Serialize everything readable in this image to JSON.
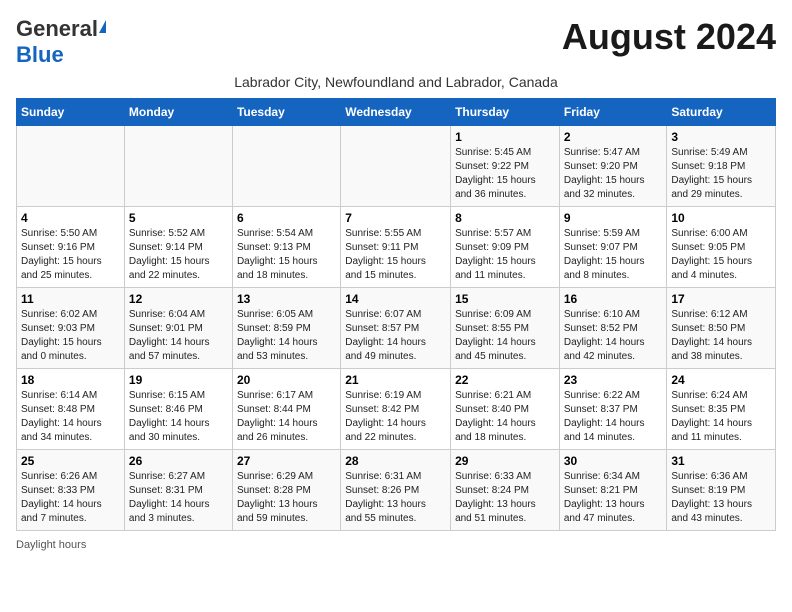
{
  "header": {
    "logo_general": "General",
    "logo_blue": "Blue",
    "month_title": "August 2024",
    "subtitle": "Labrador City, Newfoundland and Labrador, Canada"
  },
  "days_of_week": [
    "Sunday",
    "Monday",
    "Tuesday",
    "Wednesday",
    "Thursday",
    "Friday",
    "Saturday"
  ],
  "footer": {
    "note": "Daylight hours"
  },
  "weeks": [
    {
      "days": [
        {
          "num": "",
          "info": ""
        },
        {
          "num": "",
          "info": ""
        },
        {
          "num": "",
          "info": ""
        },
        {
          "num": "",
          "info": ""
        },
        {
          "num": "1",
          "info": "Sunrise: 5:45 AM\nSunset: 9:22 PM\nDaylight: 15 hours\nand 36 minutes."
        },
        {
          "num": "2",
          "info": "Sunrise: 5:47 AM\nSunset: 9:20 PM\nDaylight: 15 hours\nand 32 minutes."
        },
        {
          "num": "3",
          "info": "Sunrise: 5:49 AM\nSunset: 9:18 PM\nDaylight: 15 hours\nand 29 minutes."
        }
      ]
    },
    {
      "days": [
        {
          "num": "4",
          "info": "Sunrise: 5:50 AM\nSunset: 9:16 PM\nDaylight: 15 hours\nand 25 minutes."
        },
        {
          "num": "5",
          "info": "Sunrise: 5:52 AM\nSunset: 9:14 PM\nDaylight: 15 hours\nand 22 minutes."
        },
        {
          "num": "6",
          "info": "Sunrise: 5:54 AM\nSunset: 9:13 PM\nDaylight: 15 hours\nand 18 minutes."
        },
        {
          "num": "7",
          "info": "Sunrise: 5:55 AM\nSunset: 9:11 PM\nDaylight: 15 hours\nand 15 minutes."
        },
        {
          "num": "8",
          "info": "Sunrise: 5:57 AM\nSunset: 9:09 PM\nDaylight: 15 hours\nand 11 minutes."
        },
        {
          "num": "9",
          "info": "Sunrise: 5:59 AM\nSunset: 9:07 PM\nDaylight: 15 hours\nand 8 minutes."
        },
        {
          "num": "10",
          "info": "Sunrise: 6:00 AM\nSunset: 9:05 PM\nDaylight: 15 hours\nand 4 minutes."
        }
      ]
    },
    {
      "days": [
        {
          "num": "11",
          "info": "Sunrise: 6:02 AM\nSunset: 9:03 PM\nDaylight: 15 hours\nand 0 minutes."
        },
        {
          "num": "12",
          "info": "Sunrise: 6:04 AM\nSunset: 9:01 PM\nDaylight: 14 hours\nand 57 minutes."
        },
        {
          "num": "13",
          "info": "Sunrise: 6:05 AM\nSunset: 8:59 PM\nDaylight: 14 hours\nand 53 minutes."
        },
        {
          "num": "14",
          "info": "Sunrise: 6:07 AM\nSunset: 8:57 PM\nDaylight: 14 hours\nand 49 minutes."
        },
        {
          "num": "15",
          "info": "Sunrise: 6:09 AM\nSunset: 8:55 PM\nDaylight: 14 hours\nand 45 minutes."
        },
        {
          "num": "16",
          "info": "Sunrise: 6:10 AM\nSunset: 8:52 PM\nDaylight: 14 hours\nand 42 minutes."
        },
        {
          "num": "17",
          "info": "Sunrise: 6:12 AM\nSunset: 8:50 PM\nDaylight: 14 hours\nand 38 minutes."
        }
      ]
    },
    {
      "days": [
        {
          "num": "18",
          "info": "Sunrise: 6:14 AM\nSunset: 8:48 PM\nDaylight: 14 hours\nand 34 minutes."
        },
        {
          "num": "19",
          "info": "Sunrise: 6:15 AM\nSunset: 8:46 PM\nDaylight: 14 hours\nand 30 minutes."
        },
        {
          "num": "20",
          "info": "Sunrise: 6:17 AM\nSunset: 8:44 PM\nDaylight: 14 hours\nand 26 minutes."
        },
        {
          "num": "21",
          "info": "Sunrise: 6:19 AM\nSunset: 8:42 PM\nDaylight: 14 hours\nand 22 minutes."
        },
        {
          "num": "22",
          "info": "Sunrise: 6:21 AM\nSunset: 8:40 PM\nDaylight: 14 hours\nand 18 minutes."
        },
        {
          "num": "23",
          "info": "Sunrise: 6:22 AM\nSunset: 8:37 PM\nDaylight: 14 hours\nand 14 minutes."
        },
        {
          "num": "24",
          "info": "Sunrise: 6:24 AM\nSunset: 8:35 PM\nDaylight: 14 hours\nand 11 minutes."
        }
      ]
    },
    {
      "days": [
        {
          "num": "25",
          "info": "Sunrise: 6:26 AM\nSunset: 8:33 PM\nDaylight: 14 hours\nand 7 minutes."
        },
        {
          "num": "26",
          "info": "Sunrise: 6:27 AM\nSunset: 8:31 PM\nDaylight: 14 hours\nand 3 minutes."
        },
        {
          "num": "27",
          "info": "Sunrise: 6:29 AM\nSunset: 8:28 PM\nDaylight: 13 hours\nand 59 minutes."
        },
        {
          "num": "28",
          "info": "Sunrise: 6:31 AM\nSunset: 8:26 PM\nDaylight: 13 hours\nand 55 minutes."
        },
        {
          "num": "29",
          "info": "Sunrise: 6:33 AM\nSunset: 8:24 PM\nDaylight: 13 hours\nand 51 minutes."
        },
        {
          "num": "30",
          "info": "Sunrise: 6:34 AM\nSunset: 8:21 PM\nDaylight: 13 hours\nand 47 minutes."
        },
        {
          "num": "31",
          "info": "Sunrise: 6:36 AM\nSunset: 8:19 PM\nDaylight: 13 hours\nand 43 minutes."
        }
      ]
    }
  ]
}
